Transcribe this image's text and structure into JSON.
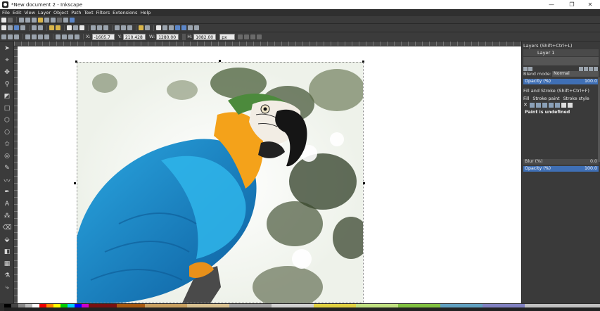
{
  "window": {
    "title": "*New document 2 - Inkscape",
    "minimize_label": "—",
    "restore_label": "❐",
    "close_label": "✕"
  },
  "menu": [
    "File",
    "Edit",
    "View",
    "Layer",
    "Object",
    "Path",
    "Text",
    "Filters",
    "Extensions",
    "Help"
  ],
  "coords": {
    "x_label": "X:",
    "x_value": "-1605.7",
    "y_label": "Y:",
    "y_value": "210.428",
    "w_label": "W:",
    "w_value": "1280.00",
    "h_label": "H:",
    "h_value": "1082.00",
    "unit": "px"
  },
  "layers_panel": {
    "title": "Layers (Shift+Ctrl+L)",
    "current_layer": "Layer 1",
    "blend_label": "Blend mode:",
    "blend_value": "Normal",
    "opacity_label": "Opacity (%)",
    "opacity_value": "100.0"
  },
  "fill_panel": {
    "title": "Fill and Stroke (Shift+Ctrl+F)",
    "tab_fill": "Fill",
    "tab_stroke_paint": "Stroke paint",
    "tab_stroke_style": "Stroke style",
    "paint_status": "Paint is undefined",
    "blur_label": "Blur (%)",
    "blur_value": "0.0",
    "opacity_label": "Opacity (%)",
    "opacity_value": "100.0"
  },
  "colors": {
    "accent": "#3f6fb5",
    "chrome": "#3a3a3a",
    "canvas": "#ffffff"
  }
}
